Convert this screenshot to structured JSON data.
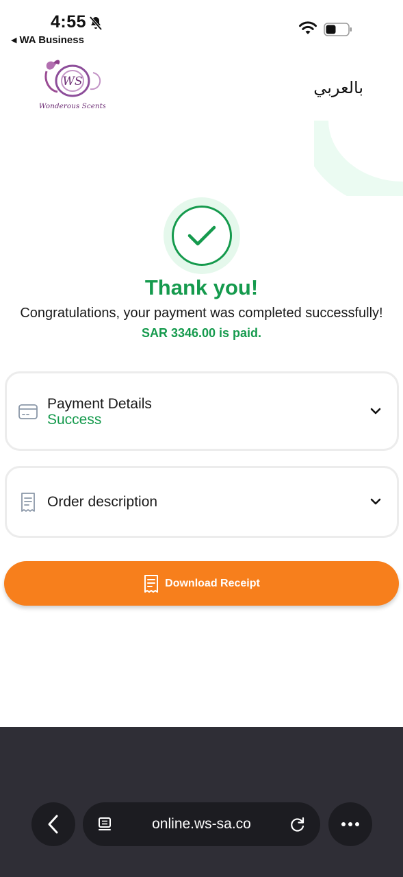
{
  "status_bar": {
    "time": "4:55",
    "back_app": "WA Business"
  },
  "header": {
    "logo_text": "Wonderous Scents",
    "logo_monogram": "WS",
    "lang_toggle": "بالعربي"
  },
  "success": {
    "title": "Thank you!",
    "message": "Congratulations, your payment was completed successfully!",
    "amount_paid": "SAR 3346.00 is paid."
  },
  "payment_card": {
    "title": "Payment Details",
    "status": "Success"
  },
  "order_card": {
    "title": "Order description"
  },
  "download": {
    "label": "Download Receipt"
  },
  "browser": {
    "url": "online.ws-sa.co"
  },
  "colors": {
    "success_green": "#159a4d",
    "accent_orange": "#f77f1c",
    "browser_bg": "#2f2e36"
  }
}
